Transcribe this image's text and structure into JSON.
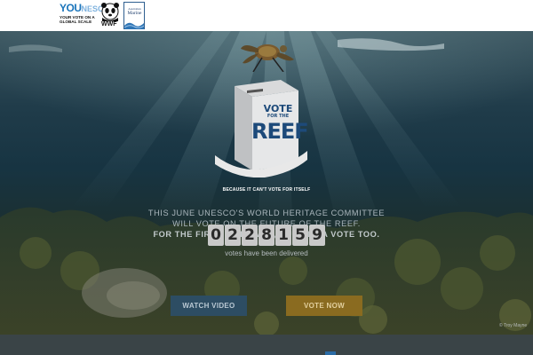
{
  "header": {
    "younesco": {
      "you": "YOU",
      "nesco": "NESCO",
      "tagline": [
        "YOUR VOTE ON A",
        "GLOBAL SCALE"
      ]
    },
    "wwf": {
      "text": "WWF"
    },
    "marine": {
      "text_top": "Australian",
      "text_main": "Marine"
    }
  },
  "hero": {
    "box": {
      "vote_line": "VOTE",
      "for_the": "FOR THE",
      "reef": "REEF",
      "tagline": "BECAUSE IT CAN'T VOTE FOR ITSELF"
    },
    "intro": {
      "line1": "THIS JUNE UNESCO'S WORLD HERITAGE COMMITTEE",
      "line2": "WILL VOTE ON THE FUTURE OF THE REEF.",
      "line3": "FOR THE FIRST TIME EVER, YOU GET A VOTE TOO."
    },
    "counter": {
      "digits": [
        "0",
        "2",
        "2",
        "8",
        "1",
        "5",
        "9"
      ],
      "label": "votes have been delivered"
    },
    "buttons": {
      "watch": "WATCH VIDEO",
      "vote": "VOTE NOW"
    },
    "credit": "© Troy Mayne"
  },
  "colors": {
    "accent_blue": "#2d4d63",
    "accent_gold": "#8a6b20",
    "brand_blue": "#1b75bb"
  }
}
